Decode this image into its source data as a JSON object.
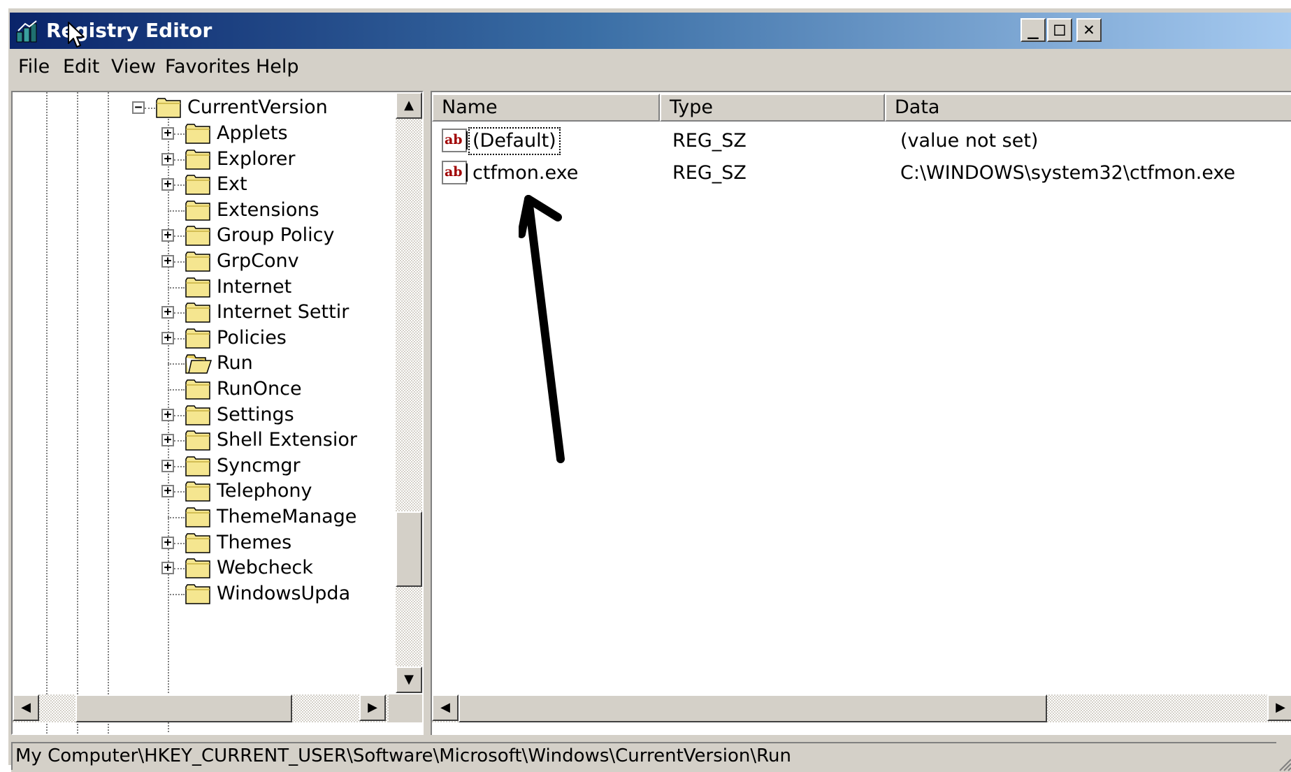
{
  "window": {
    "title": "Registry Editor",
    "controls": {
      "minimize": "_",
      "maximize": "□",
      "close": "✕"
    }
  },
  "menu": [
    "File",
    "Edit",
    "View",
    "Favorites",
    "Help"
  ],
  "tree": {
    "parent": {
      "label": "CurrentVersion",
      "expanded": true,
      "expander": "−"
    },
    "children": [
      {
        "label": "Applets",
        "expander": "+"
      },
      {
        "label": "Explorer",
        "expander": "+"
      },
      {
        "label": "Ext",
        "expander": "+"
      },
      {
        "label": "Extensions",
        "expander": ""
      },
      {
        "label": "Group Policy",
        "expander": "+"
      },
      {
        "label": "GrpConv",
        "expander": "+"
      },
      {
        "label": "Internet",
        "expander": ""
      },
      {
        "label": "Internet Settir",
        "expander": "+"
      },
      {
        "label": "Policies",
        "expander": "+"
      },
      {
        "label": "Run",
        "expander": "",
        "selected": true,
        "open": true
      },
      {
        "label": "RunOnce",
        "expander": ""
      },
      {
        "label": "Settings",
        "expander": "+"
      },
      {
        "label": "Shell Extensior",
        "expander": "+"
      },
      {
        "label": "Syncmgr",
        "expander": "+"
      },
      {
        "label": "Telephony",
        "expander": "+"
      },
      {
        "label": "ThemeManage",
        "expander": ""
      },
      {
        "label": "Themes",
        "expander": "+"
      },
      {
        "label": "Webcheck",
        "expander": "+"
      },
      {
        "label": "WindowsUpda",
        "expander": ""
      }
    ]
  },
  "list": {
    "columns": [
      "Name",
      "Type",
      "Data"
    ],
    "rows": [
      {
        "name": "(Default)",
        "type": "REG_SZ",
        "data": "(value not set)",
        "icon": "string-value-icon",
        "focused": true
      },
      {
        "name": "ctfmon.exe",
        "type": "REG_SZ",
        "data": "C:\\WINDOWS\\system32\\ctfmon.exe",
        "icon": "string-value-icon"
      }
    ]
  },
  "status": {
    "path": "My Computer\\HKEY_CURRENT_USER\\Software\\Microsoft\\Windows\\CurrentVersion\\Run"
  },
  "scroll": {
    "left_arrow": "◀",
    "right_arrow": "▶",
    "up_arrow": "▲",
    "down_arrow": "▼"
  },
  "colors": {
    "titlebar_start": "#0a246a",
    "titlebar_end": "#a6caf0",
    "chrome": "#d4d0c8",
    "folder": "#f5e690"
  }
}
